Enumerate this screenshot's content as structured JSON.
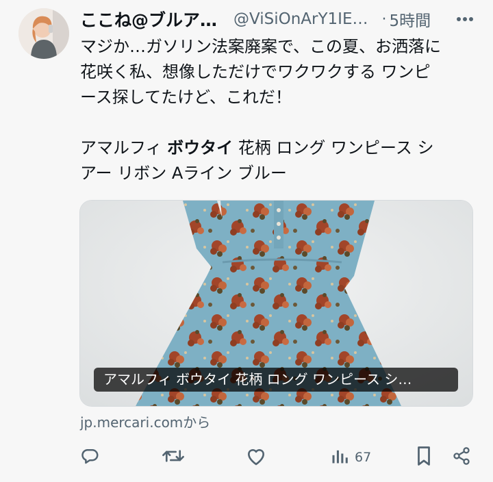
{
  "author": {
    "display_name": "ここね@ブルア…",
    "handle": "@ViSiOnArY1IE…",
    "separator": "·",
    "time": "5時間",
    "avatar": "avatar-photo"
  },
  "menu_icon": "more-icon",
  "text": {
    "line1": "マジか…ガソリン法案廃案で、この夏、お洒落に",
    "line2": "花咲く私、想像しただけでワクワクする ワンピ",
    "line3": "ース探してたけど、これだ！",
    "product_prefix": "アマルフィ ",
    "product_bold": "ボウタイ",
    "product_suffix": " 花柄 ロング ワンピース シ",
    "product_line2": "アー リボン Aライン ブルー"
  },
  "card": {
    "caption": "アマルフィ ボウタイ 花柄 ロング ワンピース シ…",
    "source": "jp.mercari.comから",
    "image": "blue-floral-dress-photo"
  },
  "actions": {
    "reply_icon": "reply-icon",
    "retweet_icon": "retweet-icon",
    "like_icon": "like-icon",
    "views_icon": "views-icon",
    "views_count": "67",
    "bookmark_icon": "bookmark-icon",
    "share_icon": "share-icon"
  },
  "colors": {
    "background": "#f7f7f7",
    "text": "#0f1419",
    "secondary": "#536471",
    "dress_blue": "#7fb0c3",
    "flower_red": "#b24a2c"
  }
}
